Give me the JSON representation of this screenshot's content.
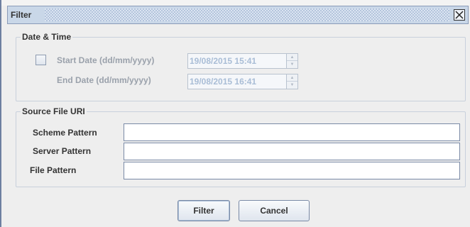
{
  "window": {
    "title": "Filter"
  },
  "date_time": {
    "legend": "Date & Time",
    "start_label": "Start Date (dd/mm/yyyy)",
    "start_value": "19/08/2015 15:41",
    "end_label": "End Date (dd/mm/yyyy)",
    "end_value": "19/08/2015 16:41",
    "enabled_checked": false
  },
  "source": {
    "legend": "Source File URI",
    "scheme_label": "Scheme Pattern",
    "server_label": "Server Pattern",
    "file_label": "File Pattern",
    "scheme_value": "",
    "server_value": "",
    "file_value": ""
  },
  "buttons": {
    "filter_label": "Filter",
    "cancel_label": "Cancel"
  },
  "icons": {
    "close": "close-icon",
    "spin_up": "chevron-up-icon",
    "spin_down": "chevron-down-icon"
  }
}
